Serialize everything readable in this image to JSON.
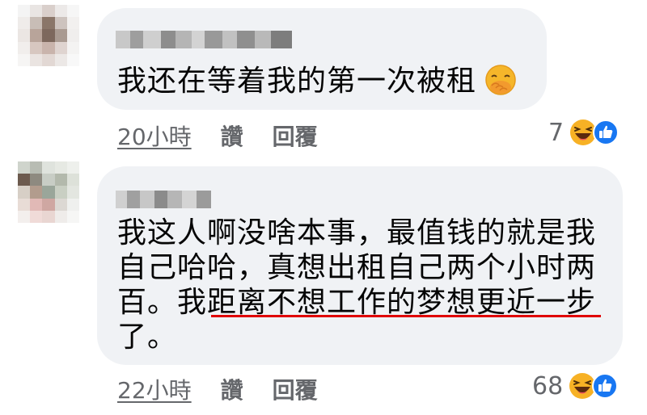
{
  "comments": [
    {
      "text_lines": [
        "我还在等着我的第一次被租"
      ],
      "emoji": "face-with-hand-over-mouth",
      "time": "20小時",
      "like_label": "讚",
      "reply_label": "回覆",
      "reaction_count": "7",
      "reactions": [
        "haha",
        "like"
      ]
    },
    {
      "text_lines": [
        "我这人啊没啥本事，最值钱的就是我",
        "自己哈哈，真想出租自己两个小时两",
        "百。我距离不想工作的梦想更近一步",
        "了。"
      ],
      "highlight": "距离不想工作的梦想更近一步",
      "highlight_color": "#e00000",
      "time": "22小時",
      "like_label": "讚",
      "reply_label": "回覆",
      "reaction_count": "68",
      "reactions": [
        "haha",
        "like"
      ]
    }
  ],
  "colors": {
    "bubble": "#f0f2f5",
    "meta_text": "#65676b",
    "like_blue": "#1877f2",
    "haha_yellow": "#f7b125"
  }
}
